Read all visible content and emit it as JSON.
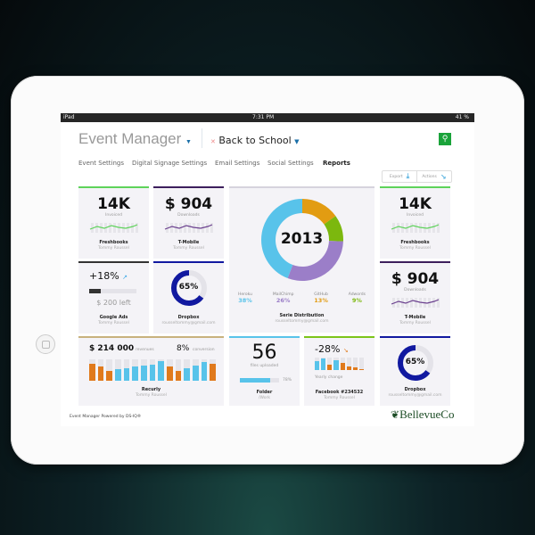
{
  "status": {
    "device": "iPad",
    "time": "7:31 PM",
    "battery": "41 %"
  },
  "header": {
    "app_title": "Event Manager",
    "event_name": "Back to School",
    "search_icon": "search-icon"
  },
  "nav": [
    {
      "label": "Event Settings"
    },
    {
      "label": "Digital Signage Settings"
    },
    {
      "label": "Email Settings"
    },
    {
      "label": "Social Settings"
    },
    {
      "label": "Reports",
      "active": true
    }
  ],
  "toolbar": {
    "export": "Export",
    "actions": "Actions"
  },
  "colors": {
    "green": "#5ed35a",
    "purple": "#3d1f5c",
    "blue": "#58c3ea",
    "navy": "#1119a0",
    "orange": "#e07a1c",
    "gold": "#c8b27d",
    "lime": "#7cc41a"
  },
  "cards": {
    "freshbooks": {
      "value": "14K",
      "label": "Invoiced",
      "name": "Freshbooks",
      "owner": "Tommy Roussel"
    },
    "tmobile": {
      "value": "$ 904",
      "label": "Downloads",
      "name": "T-Mobile",
      "owner": "Tommy Roussel"
    },
    "google": {
      "value": "+18%",
      "progress": 0.25,
      "left": "$ 200 left",
      "name": "Google Ads",
      "owner": "Tommy Roussel"
    },
    "dropbox": {
      "value": "65%",
      "percent": 65,
      "name": "Dropbox",
      "owner": "rousseltommy@gmail.com"
    },
    "distribution": {
      "year": "2013",
      "name": "Serie Distribution",
      "owner": "rousseltommy@gmail.com",
      "segments": [
        {
          "label": "Heroku",
          "value": "38%",
          "num": 38,
          "color": "#58c3ea"
        },
        {
          "label": "MailChimp",
          "value": "26%",
          "num": 26,
          "color": "#9b7ec8"
        },
        {
          "label": "GitHub",
          "value": "13%",
          "num": 13,
          "color": "#e29c12"
        },
        {
          "label": "Adwords",
          "value": "9%",
          "num": 9,
          "color": "#7cb80e"
        }
      ]
    },
    "recurly": {
      "revenue": "$ 214 000",
      "revenue_label": "revenues",
      "conversion": "8%",
      "conversion_label": "conversion",
      "name": "Recurly",
      "owner": "Tommy Roussel",
      "bars": [
        {
          "v": 0.8,
          "c": "o"
        },
        {
          "v": 0.68,
          "c": "o"
        },
        {
          "v": 0.45,
          "c": "o"
        },
        {
          "v": 0.55,
          "c": "b"
        },
        {
          "v": 0.57,
          "c": "b"
        },
        {
          "v": 0.66,
          "c": "b"
        },
        {
          "v": 0.72,
          "c": "b"
        },
        {
          "v": 0.76,
          "c": "b"
        },
        {
          "v": 0.9,
          "c": "b"
        },
        {
          "v": 0.65,
          "c": "o"
        },
        {
          "v": 0.45,
          "c": "o"
        },
        {
          "v": 0.6,
          "c": "b"
        },
        {
          "v": 0.7,
          "c": "b"
        },
        {
          "v": 0.86,
          "c": "b"
        },
        {
          "v": 0.8,
          "c": "o"
        }
      ]
    },
    "folder": {
      "value": "56",
      "label": "files uploaded",
      "progress": "78%",
      "progress_num": 78,
      "name": "Folder",
      "owner": "/Work"
    },
    "facebook": {
      "value": "-28%",
      "label": "Yearly change",
      "name": "Facebook #234532",
      "owner": "Tommy Roussel",
      "bars": [
        {
          "v": 0.7,
          "c": "b"
        },
        {
          "v": 0.95,
          "c": "b"
        },
        {
          "v": 0.4,
          "c": "o"
        },
        {
          "v": 0.8,
          "c": "b"
        },
        {
          "v": 0.6,
          "c": "o"
        },
        {
          "v": 0.3,
          "c": "o"
        },
        {
          "v": 0.18,
          "c": "o"
        },
        {
          "v": 0.1,
          "c": "o"
        }
      ]
    },
    "freshbooks2": {
      "value": "14K",
      "label": "Invoiced",
      "name": "Freshbooks",
      "owner": "Tommy Roussel"
    },
    "tmobile2": {
      "value": "$ 904",
      "label": "Downloads",
      "name": "T-Mobile",
      "owner": "Tommy Roussel"
    },
    "dropbox2": {
      "value": "65%",
      "percent": 65,
      "name": "Dropbox",
      "owner": "rousseltommy@gmail.com"
    }
  },
  "footer": {
    "text": "Event Manager Powered by DS-IQ®",
    "logo": "BellevueCo"
  }
}
